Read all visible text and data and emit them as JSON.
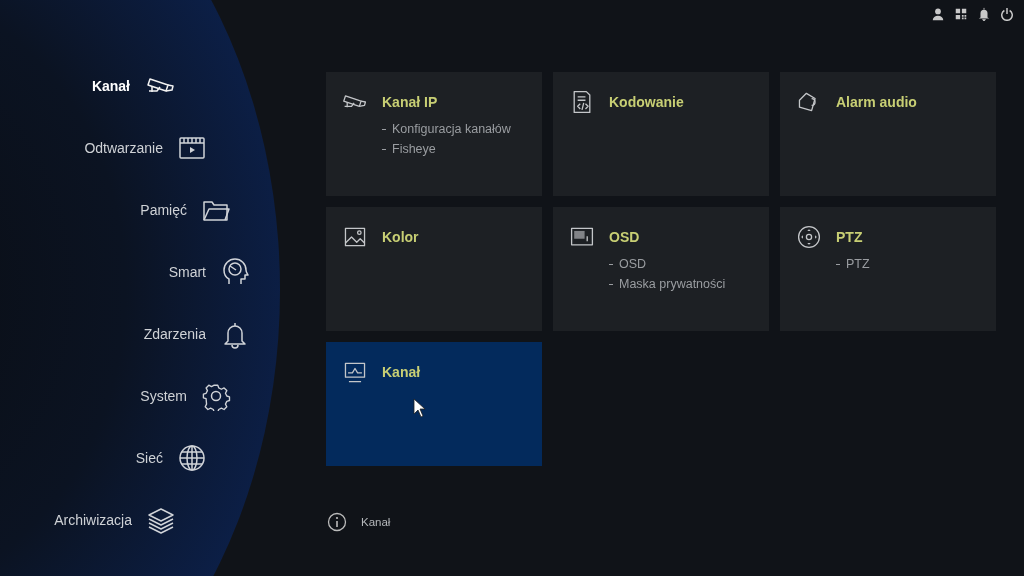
{
  "top_bar": {
    "icons": [
      {
        "kind": "user"
      },
      {
        "kind": "qr"
      },
      {
        "kind": "bell"
      },
      {
        "kind": "power"
      }
    ]
  },
  "sidebar": {
    "items": [
      {
        "label": "Kanał",
        "kind": "camera",
        "selected": true
      },
      {
        "label": "Odtwarzanie",
        "kind": "playback",
        "selected": false
      },
      {
        "label": "Pamięć",
        "kind": "folder",
        "selected": false
      },
      {
        "label": "Smart",
        "kind": "head",
        "selected": false
      },
      {
        "label": "Zdarzenia",
        "kind": "bell",
        "selected": false
      },
      {
        "label": "System",
        "kind": "gear",
        "selected": false
      },
      {
        "label": "Sieć",
        "kind": "globe",
        "selected": false
      },
      {
        "label": "Archiwizacja",
        "kind": "layers",
        "selected": false
      }
    ]
  },
  "tiles": [
    {
      "title": "Kanał IP",
      "kind": "camera",
      "selected": false,
      "items": [
        "Konfiguracja kanałów",
        "Fisheye"
      ]
    },
    {
      "title": "Kodowanie",
      "kind": "code",
      "selected": false
    },
    {
      "title": "Alarm audio",
      "kind": "speaker",
      "selected": false
    },
    {
      "title": "Kolor",
      "kind": "image",
      "selected": false
    },
    {
      "title": "OSD",
      "kind": "osd",
      "selected": false,
      "items": [
        "OSD",
        "Maska prywatności"
      ]
    },
    {
      "title": "PTZ",
      "kind": "ptz",
      "selected": false,
      "items": [
        "PTZ"
      ]
    },
    {
      "title": "Kanał",
      "kind": "monitor",
      "selected": true
    }
  ],
  "info": {
    "text": "Kanał"
  }
}
